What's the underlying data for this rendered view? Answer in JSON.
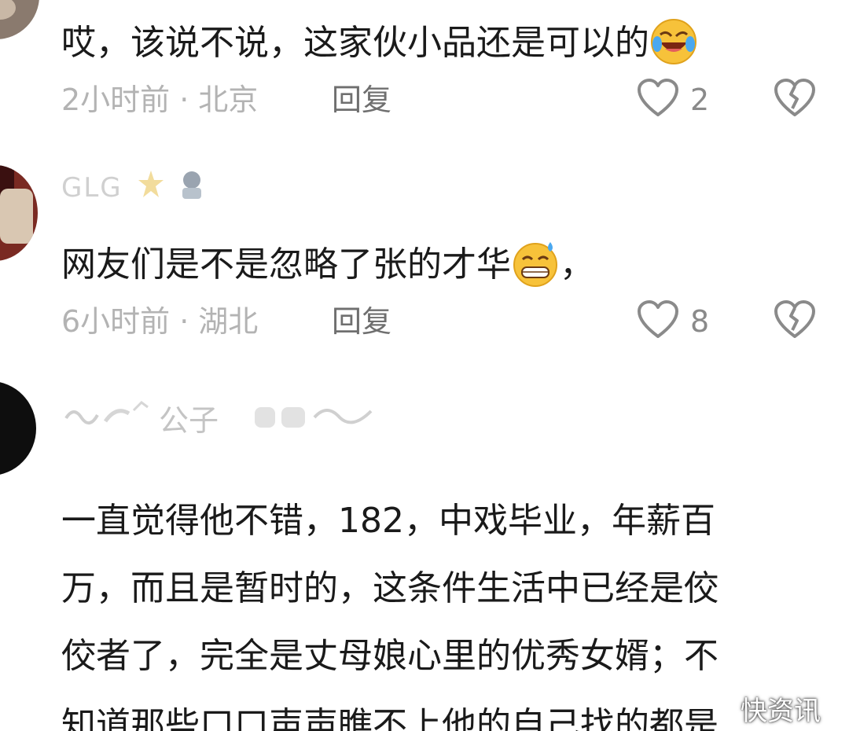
{
  "comments": [
    {
      "text": "哎，该说不说，这家伙小品还是可以的",
      "emoji": "laughing-crying-emoji",
      "time": "2小时前",
      "location": "北京",
      "reply_label": "回复",
      "likes": "2"
    },
    {
      "username": "GLG",
      "text": "网友们是不是忽略了张的才华",
      "emoji": "grinning-sweat-emoji",
      "text_suffix": "，",
      "time": "6小时前",
      "location": "湖北",
      "reply_label": "回复",
      "likes": "8"
    },
    {
      "username": "公子",
      "text_lines": [
        "一直觉得他不错，182，中戏毕业，年薪百",
        "万，而且是暂时的，这条件生活中已经是佼",
        "佼者了，完全是丈母娘心里的优秀女婿；不",
        "知道那些口口声声瞧不上他的自己找的都是"
      ]
    }
  ],
  "separator": "·",
  "watermark": "快资讯",
  "colors": {
    "meta_gray": "#b3b3b3",
    "reply_gray": "#6f6f6f",
    "text": "#1a1a1a",
    "icon_gray": "#8a8a8a"
  }
}
